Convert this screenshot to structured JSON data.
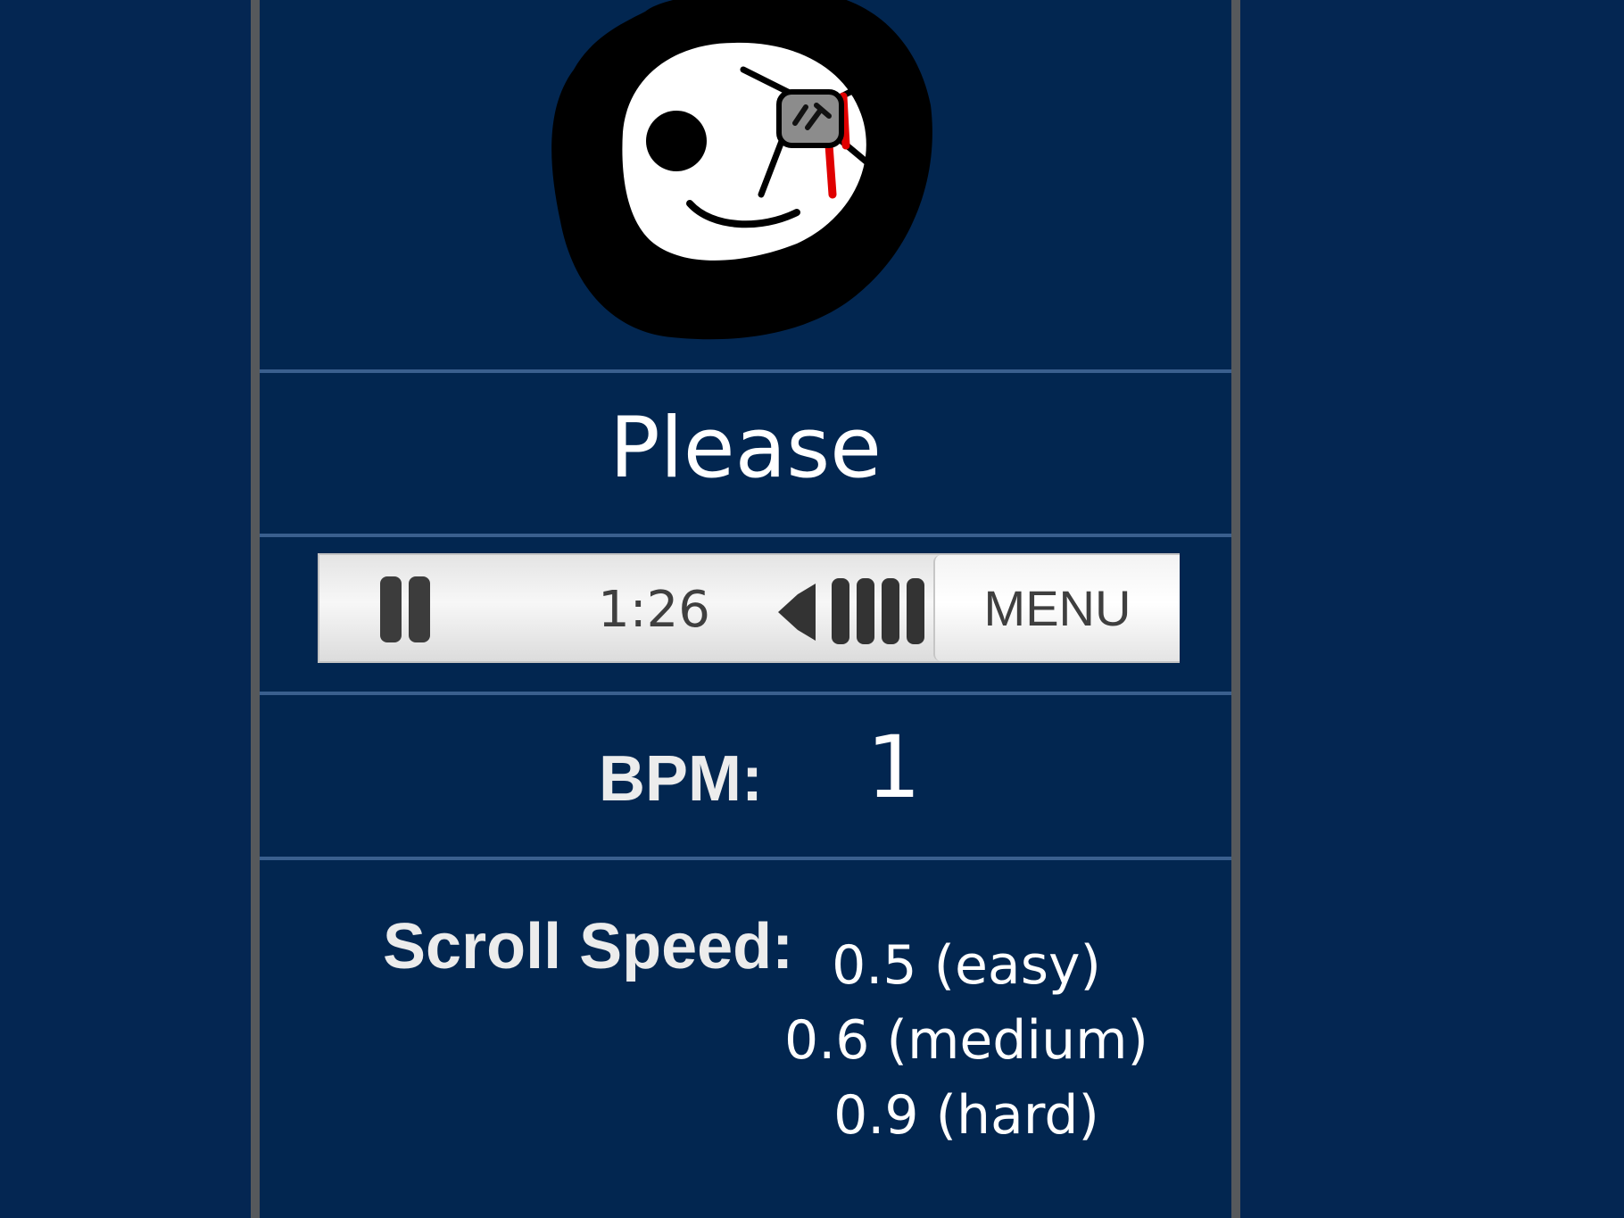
{
  "song": {
    "title": "Please"
  },
  "player": {
    "time": "1:26",
    "menu_label": "MENU",
    "icons": {
      "pause": "pause-icon",
      "volume": "speaker-icon"
    }
  },
  "bpm": {
    "label": "BPM:",
    "value": "1"
  },
  "scroll_speed": {
    "label": "Scroll Speed:",
    "options": [
      "0.5 (easy)",
      "0.6 (medium)",
      "0.9 (hard)"
    ]
  },
  "colors": {
    "background": "#042652",
    "panel": "#022650",
    "panel_border": "#56595c",
    "divider": "#3a5f8e",
    "text": "#ffffff",
    "player_bar": "#e8e8e8",
    "blood_red": "#e00000"
  }
}
